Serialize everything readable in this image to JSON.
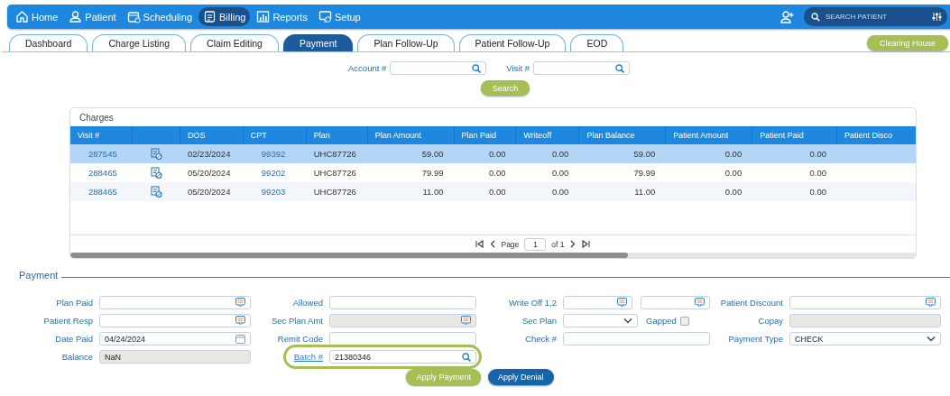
{
  "nav": {
    "items": [
      {
        "label": "Home",
        "selected": false
      },
      {
        "label": "Patient",
        "selected": false
      },
      {
        "label": "Scheduling",
        "selected": false
      },
      {
        "label": "Billing",
        "selected": true
      },
      {
        "label": "Reports",
        "selected": false
      },
      {
        "label": "Setup",
        "selected": false
      }
    ],
    "search": {
      "placeholder": "SEARCH PATIENT"
    }
  },
  "tabs": [
    {
      "label": "Dashboard",
      "selected": false
    },
    {
      "label": "Charge Listing",
      "selected": false
    },
    {
      "label": "Claim Editing",
      "selected": false
    },
    {
      "label": "Payment",
      "selected": true
    },
    {
      "label": "Plan Follow-Up",
      "selected": false
    },
    {
      "label": "Patient Follow-Up",
      "selected": false
    },
    {
      "label": "EOD",
      "selected": false
    }
  ],
  "clearing_house_button": "Clearing House",
  "lookup": {
    "fields": [
      {
        "label": "Account #"
      },
      {
        "label": "Visit #"
      }
    ],
    "button": "Search"
  },
  "charges": {
    "title": "Charges",
    "columns": [
      {
        "label": "Visit #",
        "kind": "link"
      },
      {
        "kind": "icon"
      },
      {
        "label": "DOS",
        "kind": "text"
      },
      {
        "label": "CPT",
        "kind": "link"
      },
      {
        "label": "Plan",
        "kind": "text"
      },
      {
        "label": "Plan Amount",
        "kind": "number"
      },
      {
        "label": "Plan Paid",
        "kind": "number"
      },
      {
        "label": "Writeoff",
        "kind": "number"
      },
      {
        "label": "Plan Balance",
        "kind": "number"
      },
      {
        "label": "Patient Amount",
        "kind": "number"
      },
      {
        "label": "Patient Paid",
        "kind": "number"
      },
      {
        "label": "Patient Disco",
        "kind": "number"
      }
    ],
    "rows": [
      {
        "selected": true,
        "cells": [
          "287545",
          "",
          "02/23/2024",
          "99392",
          "UHC87726",
          "59.00",
          "0.00",
          "0.00",
          "59.00",
          "0.00",
          "0.00"
        ]
      },
      {
        "selected": false,
        "cells": [
          "288465",
          "",
          "05/20/2024",
          "99202",
          "UHC87726",
          "79.99",
          "0.00",
          "0.00",
          "79.99",
          "0.00",
          "0.00"
        ]
      },
      {
        "selected": false,
        "cells": [
          "288465",
          "",
          "05/20/2024",
          "99203",
          "UHC87726",
          "11.00",
          "0.00",
          "0.00",
          "11.00",
          "0.00",
          "0.00"
        ]
      }
    ],
    "pager": {
      "page_label": "Page",
      "page": "1",
      "of": "of 1"
    }
  },
  "payment": {
    "title": "Payment",
    "rows": [
      [
        {
          "label": "Plan Paid",
          "fields": [
            {
              "kind": "note",
              "disabled": false
            }
          ]
        },
        {
          "label": "Allowed",
          "fields": [
            {
              "kind": "text",
              "disabled": false
            }
          ]
        },
        {
          "label": "Write Off 1,2",
          "fields": [
            {
              "kind": "note",
              "disabled": false
            },
            {
              "kind": "note",
              "disabled": false
            }
          ]
        },
        {
          "label": "Patient Discount",
          "fields": [
            {
              "kind": "note",
              "disabled": false
            }
          ]
        }
      ],
      [
        {
          "label": "Patient Resp",
          "fields": [
            {
              "kind": "note",
              "disabled": false
            }
          ]
        },
        {
          "label": "Sec Plan Amt",
          "fields": [
            {
              "kind": "note",
              "disabled": true
            }
          ]
        },
        {
          "label": "Sec Plan",
          "fields": [
            {
              "kind": "select",
              "disabled": false
            },
            {
              "kind": "checkbox",
              "label": "Gapped",
              "checked": false
            }
          ]
        },
        {
          "label": "Copay",
          "fields": [
            {
              "kind": "text",
              "disabled": true
            }
          ]
        }
      ],
      [
        {
          "label": "Date Paid",
          "fields": [
            {
              "kind": "date",
              "value": "04/24/2024",
              "disabled": false
            }
          ]
        },
        {
          "label": "Remit Code",
          "fields": [
            {
              "kind": "text",
              "disabled": false
            }
          ]
        },
        {
          "label": "Check #",
          "fields": [
            {
              "kind": "text",
              "disabled": false
            }
          ]
        },
        {
          "label": "Payment Type",
          "fields": [
            {
              "kind": "select",
              "value": "CHECK",
              "disabled": false
            }
          ]
        }
      ],
      [
        {
          "label": "Balance",
          "fields": [
            {
              "kind": "text",
              "value": "NaN",
              "disabled": true
            }
          ]
        },
        {
          "label": "Batch #",
          "link": true,
          "highlighted": true,
          "fields": [
            {
              "kind": "search",
              "value": "21380346",
              "disabled": false
            }
          ]
        }
      ]
    ],
    "buttons": [
      {
        "label": "Apply Payment",
        "kind": "primary"
      },
      {
        "label": "Apply Denial",
        "kind": "secondary"
      }
    ]
  }
}
